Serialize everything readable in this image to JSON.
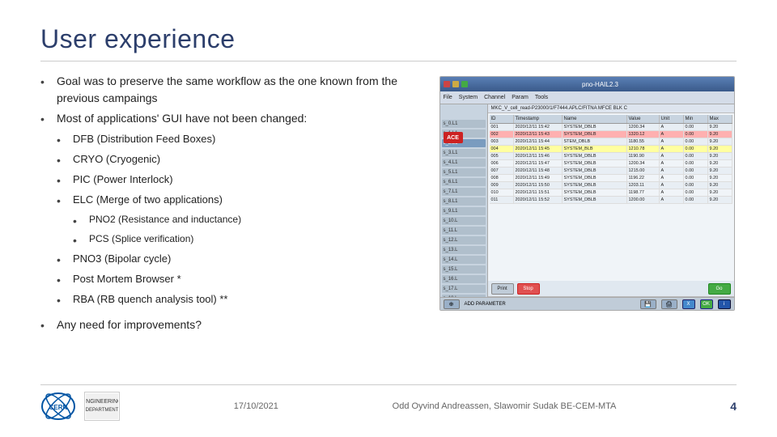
{
  "slide": {
    "title": "User experience",
    "bullets": [
      {
        "level": 1,
        "text": "Goal was to preserve the same workflow as the one known from the previous campaings"
      },
      {
        "level": 1,
        "text": "Most of applications' GUI have not been changed:"
      },
      {
        "level": 2,
        "text": "DFB (Distribution Feed Boxes)"
      },
      {
        "level": 2,
        "text": "CRYO (Cryogenic)"
      },
      {
        "level": 2,
        "text": "PIC (Power Interlock)"
      },
      {
        "level": 2,
        "text": "ELC (Merge of two applications)"
      },
      {
        "level": 3,
        "text": "PNO2 (Resistance and inductance)"
      },
      {
        "level": 3,
        "text": "PCS (Splice verification)"
      },
      {
        "level": 2,
        "text": "PNO3 (Bipolar cycle)"
      },
      {
        "level": 2,
        "text": "Post Mortem Browser *"
      },
      {
        "level": 2,
        "text": "RBA (RB quench analysis tool) **"
      },
      {
        "level": 1,
        "text": "Any need for improvements?"
      }
    ],
    "screenshot": {
      "title": "pno-HAIL2.3",
      "app_name": "ACE"
    }
  },
  "footer": {
    "date": "17/10/2021",
    "authors": "Odd Oyvind Andreassen, Slawomir Sudak BE-CEM-MTA",
    "page": "4"
  }
}
